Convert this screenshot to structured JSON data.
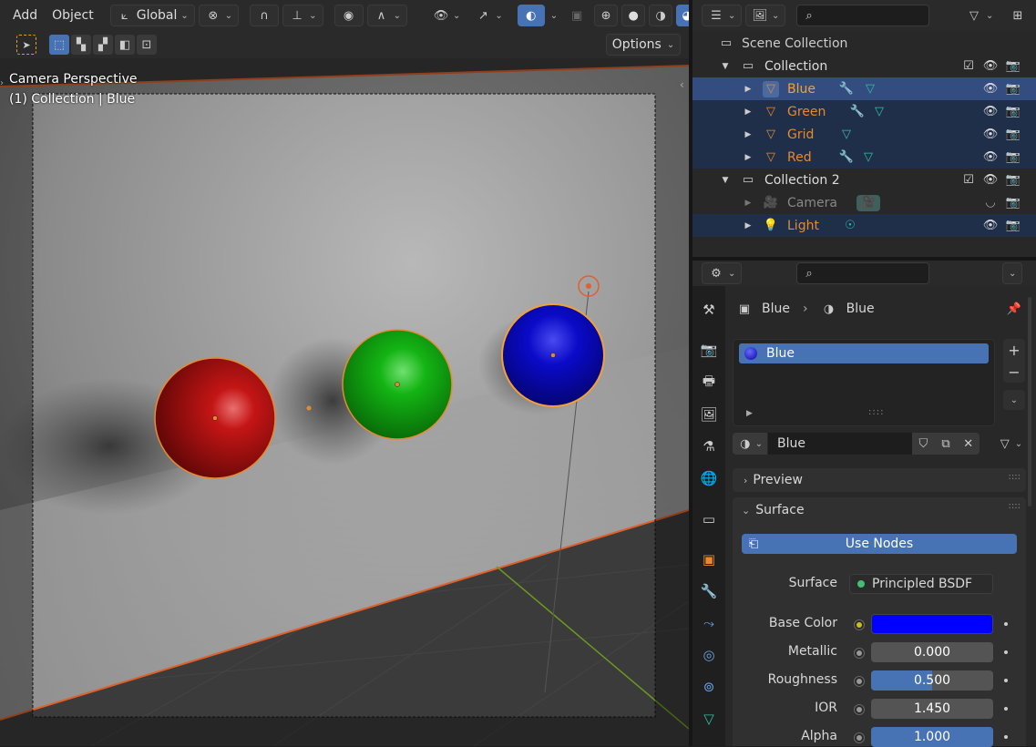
{
  "viewport": {
    "menu": [
      "Add",
      "Object"
    ],
    "orientation": "Global",
    "options_label": "Options",
    "overlay_title": "Camera Perspective",
    "overlay_sub": "(1) Collection | Blue"
  },
  "outliner": {
    "rows": [
      {
        "label": "Scene Collection"
      },
      {
        "label": "Collection"
      },
      {
        "label": "Blue"
      },
      {
        "label": "Green"
      },
      {
        "label": "Grid"
      },
      {
        "label": "Red"
      },
      {
        "label": "Collection 2"
      },
      {
        "label": "Camera"
      },
      {
        "label": "Light"
      }
    ]
  },
  "properties": {
    "breadcrumb_object": "Blue",
    "breadcrumb_material": "Blue",
    "slot_name": "Blue",
    "material_name": "Blue",
    "preview_label": "Preview",
    "surface_panel": "Surface",
    "use_nodes": "Use Nodes",
    "surface_label": "Surface",
    "surface_value": "Principled BSDF",
    "base_color_label": "Base Color",
    "base_color_hex": "#0000ff",
    "metallic_label": "Metallic",
    "metallic_value": "0.000",
    "metallic_fill": 0.0,
    "roughness_label": "Roughness",
    "roughness_value": "0.500",
    "roughness_fill": 0.5,
    "ior_label": "IOR",
    "ior_value": "1.450",
    "alpha_label": "Alpha",
    "alpha_value": "1.000",
    "alpha_fill": 1.0
  },
  "colors": {
    "accent": "#4772b3",
    "selected_orange": "#f5a030",
    "object_orange": "#e58a2f",
    "red_sphere": "#c01010",
    "green_sphere": "#10b020",
    "blue_sphere": "#0c10c8"
  }
}
